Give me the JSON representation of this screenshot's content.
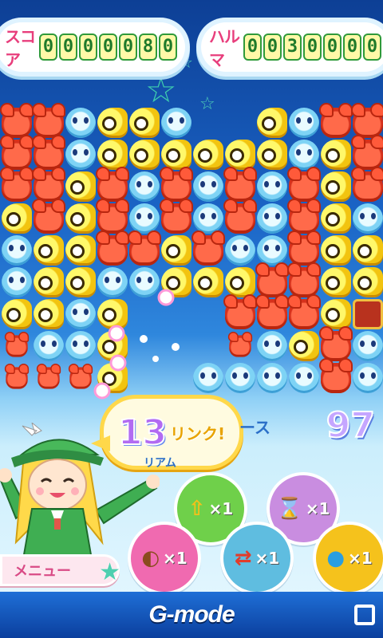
{
  "score": {
    "label": "スコア",
    "digits": [
      "0",
      "0",
      "0",
      "0",
      "0",
      "8",
      "0"
    ]
  },
  "hiscore": {
    "label": "ハルマ",
    "digits": [
      "0",
      "0",
      "3",
      "0",
      "0",
      "0",
      "0"
    ]
  },
  "combo": {
    "number": "13",
    "word": "リンク!"
  },
  "peek_texts": {
    "right": "ース",
    "left": "リアム"
  },
  "timer": "97",
  "items": [
    {
      "name": "up-arrow",
      "icon": "⇧",
      "count": "×1",
      "color": "#6fd04a"
    },
    {
      "name": "hourglass",
      "icon": "⌛",
      "count": "×1",
      "color": "#c98de0"
    },
    {
      "name": "bag",
      "icon": "◐",
      "count": "×1",
      "color": "#f06ab0"
    },
    {
      "name": "swap",
      "icon": "⇄",
      "count": "×1",
      "color": "#5fbde0"
    },
    {
      "name": "bubble",
      "icon": "●",
      "count": "×1",
      "color": "#f5c21c"
    }
  ],
  "menu": {
    "label": "メニュー"
  },
  "footer": {
    "brand": "G-mode"
  },
  "board": {
    "rows": [
      "C C P F F P . . F P C C",
      "C C P F F F F F F P F C",
      "C C F C P C P C P C F C",
      "F C F C P C P C P C F P",
      "P F F C C F C P P C F F",
      "P F F P P F F F C C F F",
      "F F P F . . . C C C F T",
      "c P P F . . . c P F C P",
      "c c c F . . P P P P C P"
    ]
  }
}
